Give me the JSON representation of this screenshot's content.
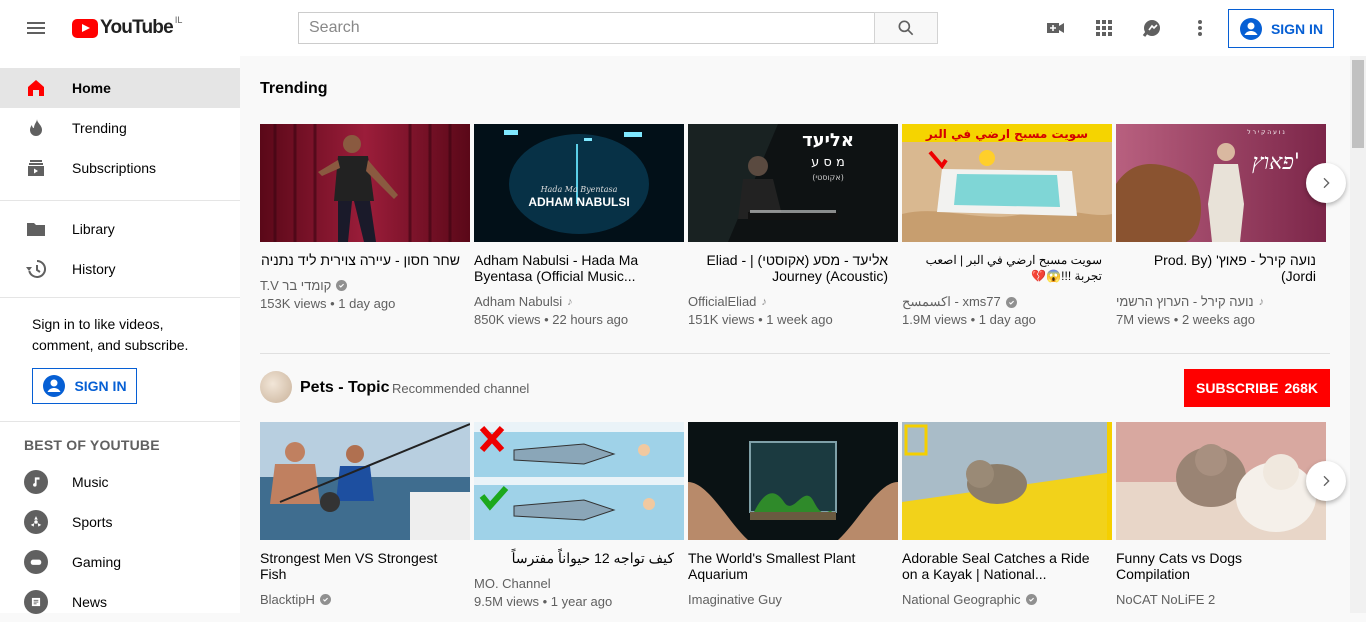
{
  "header": {
    "logo_text": "YouTube",
    "country": "IL",
    "search_placeholder": "Search",
    "signin_label": "SIGN IN"
  },
  "sidebar": {
    "items": [
      {
        "label": "Home",
        "icon": "home-icon"
      },
      {
        "label": "Trending",
        "icon": "trending-icon"
      },
      {
        "label": "Subscriptions",
        "icon": "subscriptions-icon"
      },
      {
        "label": "Library",
        "icon": "library-icon"
      },
      {
        "label": "History",
        "icon": "history-icon"
      }
    ],
    "signin_prompt": "Sign in to like videos, comment, and subscribe.",
    "signin_label": "SIGN IN",
    "best_title": "BEST OF YOUTUBE",
    "best_items": [
      {
        "label": "Music",
        "icon": "music-icon"
      },
      {
        "label": "Sports",
        "icon": "sports-icon"
      },
      {
        "label": "Gaming",
        "icon": "gaming-icon"
      },
      {
        "label": "News",
        "icon": "news-icon"
      }
    ]
  },
  "trending": {
    "title": "Trending",
    "videos": [
      {
        "title": "שחר חסון - עיירה צוירית ליד נתניה",
        "channel": "קומדי בר T.V",
        "meta": "153K views • 1 day ago",
        "verified": true
      },
      {
        "title": "Adham Nabulsi - Hada Ma Byentasa (Official Music...",
        "channel": "Adham Nabulsi",
        "meta": "850K views • 22 hours ago",
        "music": true
      },
      {
        "title": "אליעד - מסע (אקוסטי) | Eliad - Journey (Acoustic)",
        "channel": "OfficialEliad",
        "meta": "151K views • 1 week ago",
        "music": true
      },
      {
        "title": "سويت مسبح ارضي في البر | اصعب تجربة !!!😱💔",
        "channel": "اكسمسح - xms77",
        "meta": "1.9M views • 1 day ago",
        "verified": true
      },
      {
        "title": "נועה קירל - פאוץ' (Prod. By Jordi)",
        "channel": "נועה קירל - הערוץ הרשמי",
        "meta": "7M views • 2 weeks ago",
        "music": true
      }
    ],
    "thumb_texts": {
      "adham": "ADHAM NABULSI",
      "adham_script": "Hada Ma Byentasa",
      "eliad": "אליעד",
      "eliad_sub": "מ ס ע",
      "eliad_small": "(אקוסטי)",
      "pool": "سويت مسبح ارضي في البر",
      "noa": "פאוץ'",
      "noa_top": "נ ו ע ה   ק י ר ל"
    }
  },
  "channel": {
    "name": "Pets - Topic",
    "label": "Recommended channel",
    "subscribe_label": "SUBSCRIBE",
    "subscriber_count": "268K",
    "videos": [
      {
        "title": "Strongest Men VS Strongest Fish",
        "channel": "BlacktipH",
        "meta": "",
        "verified": true
      },
      {
        "title": "كيف تواجه 12 حيواناً مفترساً",
        "channel": "MO. Channel",
        "meta": "9.5M views • 1 year ago"
      },
      {
        "title": "The World's Smallest Plant Aquarium",
        "channel": "Imaginative Guy",
        "meta": ""
      },
      {
        "title": "Adorable Seal Catches a Ride on a Kayak | National...",
        "channel": "National Geographic",
        "meta": "",
        "verified": true
      },
      {
        "title": "Funny Cats vs Dogs Compilation",
        "channel": "NoCAT NoLiFE 2",
        "meta": ""
      }
    ]
  },
  "colors": {
    "brand_red": "#ff0000",
    "link_blue": "#065fd4",
    "text_secondary": "#606060"
  }
}
